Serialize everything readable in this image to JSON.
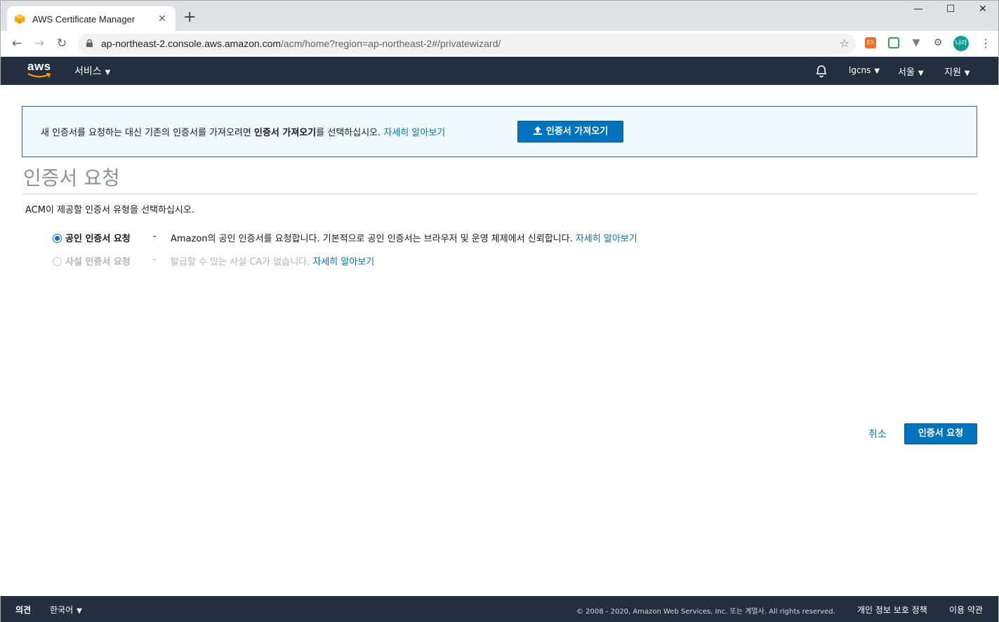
{
  "browser": {
    "tab_title": "AWS Certificate Manager",
    "url_host": "ap-northeast-2.console.aws.amazon.com",
    "url_path": "/acm/home?region=ap-northeast-2#/privatewizard/",
    "avatar_label": "나라",
    "new_tab_label": "+",
    "close_tab_label": "✕"
  },
  "aws_header": {
    "logo_text": "aws",
    "services_label": "서비스",
    "account_label": "lgcns",
    "region_label": "서울",
    "support_label": "지원"
  },
  "info_banner": {
    "text_before": "새 인증서를 요청하는 대신 기존의 인증서를 가져오려면 ",
    "text_bold": "인증서 가져오기",
    "text_after": "를 선택하십시오. ",
    "learn_more": "자세히 알아보기",
    "import_button": "인증서 가져오기"
  },
  "page": {
    "title": "인증서 요청",
    "instruction": "ACM이 제공할 인증서 유형을 선택하십시오."
  },
  "options": [
    {
      "label": "공인 인증서 요청",
      "dash": "-",
      "description": "Amazon의 공인 인증서를 요청합니다. 기본적으로 공인 인증서는 브라우저 및 운영 체제에서 신뢰합니다. ",
      "learn_more": "자세히 알아보기",
      "selected": true,
      "disabled": false
    },
    {
      "label": "사설 인증서 요청",
      "dash": "-",
      "description": "발급할 수 있는 사설 CA가 없습니다. ",
      "learn_more": "자세히 알아보기",
      "selected": false,
      "disabled": true
    }
  ],
  "actions": {
    "cancel": "취소",
    "submit": "인증서 요청"
  },
  "footer": {
    "feedback": "의견",
    "language": "한국어",
    "copyright": "© 2008 - 2020, Amazon Web Services, Inc. 또는 계열사. All rights reserved.",
    "privacy": "개인 정보 보호 정책",
    "terms": "이용 약관"
  },
  "colors": {
    "aws_header": "#232f3e",
    "link": "#0073bb",
    "primary_button": "#0073bb",
    "info_background": "#f1faff"
  }
}
